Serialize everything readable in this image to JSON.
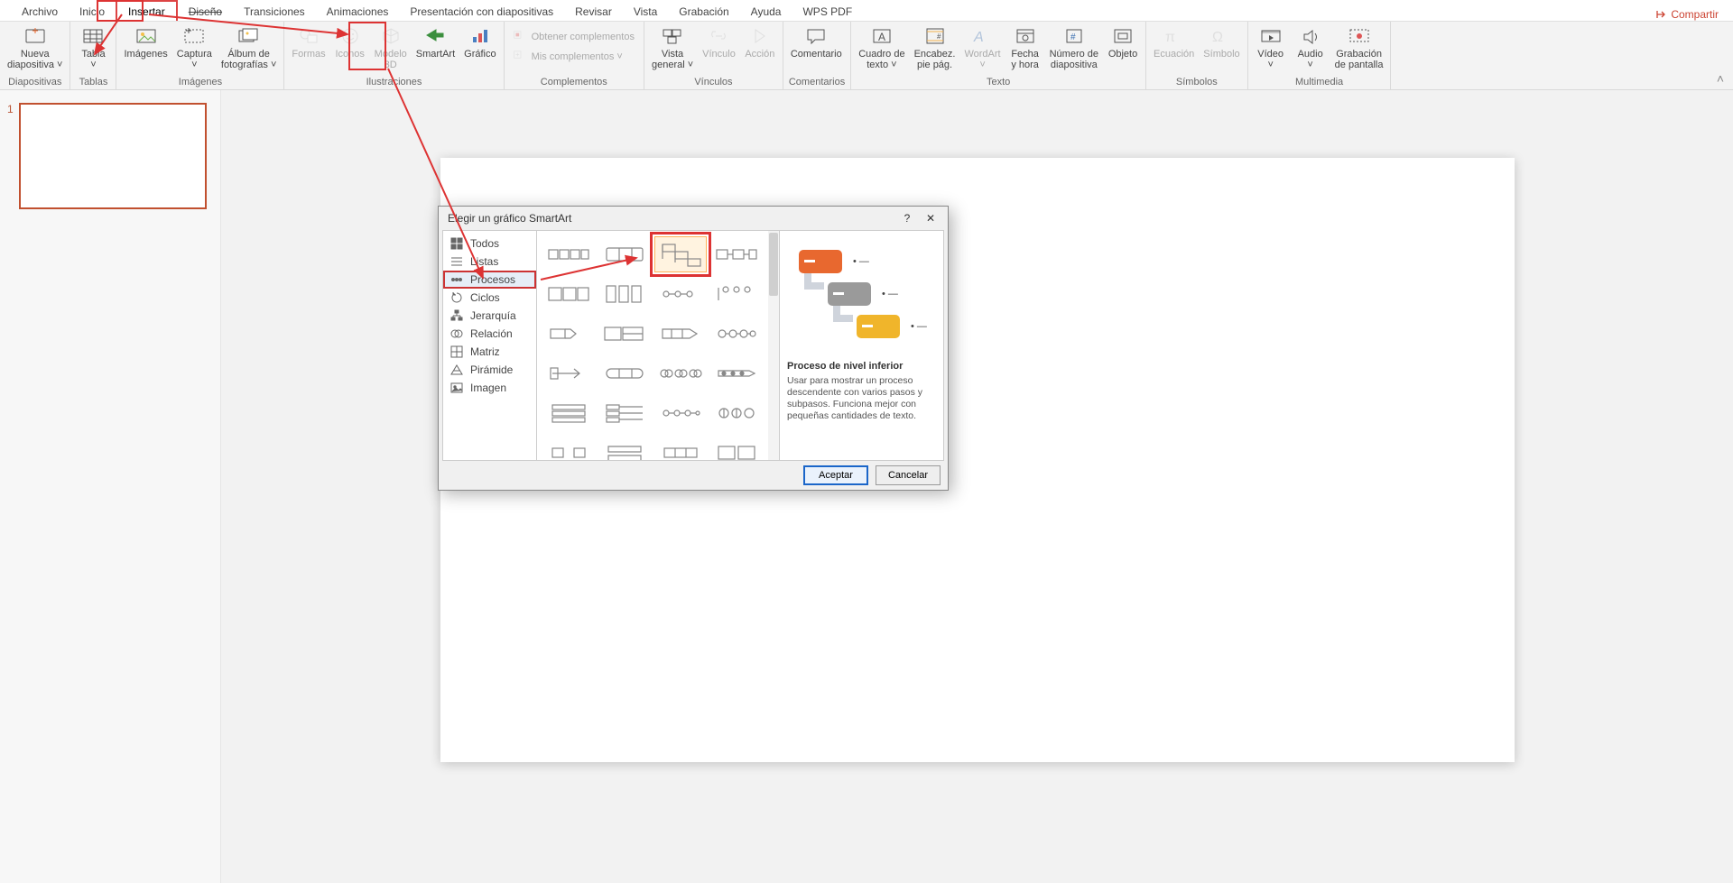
{
  "menu": {
    "items": [
      "Archivo",
      "Inicio",
      "Insertar",
      "Diseño",
      "Transiciones",
      "Animaciones",
      "Presentación con diapositivas",
      "Revisar",
      "Vista",
      "Grabación",
      "Ayuda",
      "WPS PDF"
    ],
    "active": "Insertar",
    "share": "Compartir"
  },
  "ribbon": {
    "groups": [
      {
        "label": "Diapositivas",
        "items": [
          {
            "n": "new-slide",
            "t": "Nueva\ndiapositiva ˅"
          }
        ]
      },
      {
        "label": "Tablas",
        "items": [
          {
            "n": "table",
            "t": "Tabla\n˅"
          }
        ]
      },
      {
        "label": "Imágenes",
        "items": [
          {
            "n": "images",
            "t": "Imágenes"
          },
          {
            "n": "capture",
            "t": "Captura\n˅"
          },
          {
            "n": "album",
            "t": "Álbum de\nfotografías ˅"
          }
        ]
      },
      {
        "label": "Ilustraciones",
        "items": [
          {
            "n": "shapes",
            "t": "Formas",
            "d": true
          },
          {
            "n": "icons",
            "t": "Iconos",
            "d": true
          },
          {
            "n": "model3d",
            "t": "Modelo\n3D",
            "d": true
          },
          {
            "n": "smartart",
            "t": "SmartArt"
          },
          {
            "n": "chart",
            "t": "Gráfico"
          }
        ]
      },
      {
        "label": "Complementos",
        "items": [
          {
            "n": "getaddin",
            "t": "Obtener complementos",
            "d": true,
            "row": true
          },
          {
            "n": "myaddin",
            "t": "Mis complementos ˅",
            "d": true,
            "row": true
          }
        ]
      },
      {
        "label": "Vínculos",
        "items": [
          {
            "n": "zoom",
            "t": "Vista\ngeneral ˅"
          },
          {
            "n": "link",
            "t": "Vínculo",
            "d": true
          },
          {
            "n": "action",
            "t": "Acción",
            "d": true
          }
        ]
      },
      {
        "label": "Comentarios",
        "items": [
          {
            "n": "comment",
            "t": "Comentario"
          }
        ]
      },
      {
        "label": "Texto",
        "items": [
          {
            "n": "textbox",
            "t": "Cuadro de\ntexto ˅"
          },
          {
            "n": "header",
            "t": "Encabez.\npie pág."
          },
          {
            "n": "wordart",
            "t": "WordArt\n˅",
            "d": true
          },
          {
            "n": "datetime",
            "t": "Fecha\ny hora"
          },
          {
            "n": "slidenum",
            "t": "Número de\ndiapositiva"
          },
          {
            "n": "object",
            "t": "Objeto"
          }
        ]
      },
      {
        "label": "Símbolos",
        "items": [
          {
            "n": "equation",
            "t": "Ecuación",
            "d": true
          },
          {
            "n": "symbol",
            "t": "Símbolo",
            "d": true
          }
        ]
      },
      {
        "label": "Multimedia",
        "items": [
          {
            "n": "video",
            "t": "Vídeo\n˅"
          },
          {
            "n": "audio",
            "t": "Audio\n˅"
          },
          {
            "n": "screenrec",
            "t": "Grabación\nde pantalla"
          }
        ]
      }
    ]
  },
  "thumb": {
    "num": "1"
  },
  "dialog": {
    "title": "Elegir un gráfico SmartArt",
    "help": "?",
    "close": "✕",
    "categories": [
      "Todos",
      "Listas",
      "Procesos",
      "Ciclos",
      "Jerarquía",
      "Relación",
      "Matriz",
      "Pirámide",
      "Imagen"
    ],
    "selectedCat": "Procesos",
    "preview": {
      "title": "Proceso de nivel inferior",
      "desc": "Usar para mostrar un proceso descendente con varios pasos y subpasos. Funciona mejor con pequeñas cantidades de texto."
    },
    "ok": "Aceptar",
    "cancel": "Cancelar"
  }
}
